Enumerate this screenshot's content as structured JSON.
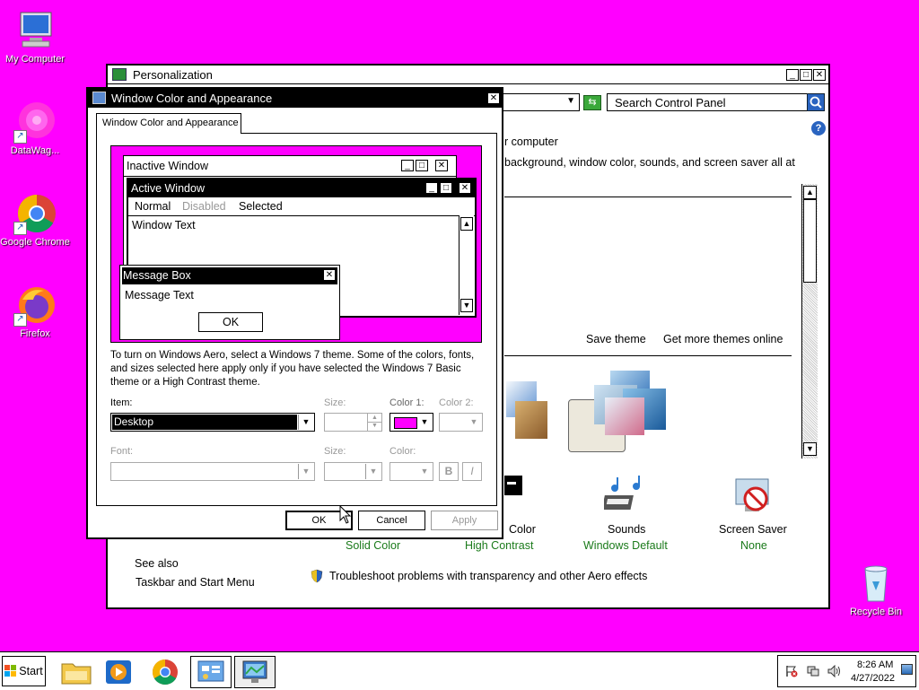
{
  "desktop": {
    "background": "#ff00ff",
    "icons": [
      {
        "label": "My Computer"
      },
      {
        "label": "DataWag..."
      },
      {
        "label": "Google Chrome"
      },
      {
        "label": "Firefox"
      },
      {
        "label": "Recycle Bin"
      }
    ]
  },
  "personalization": {
    "title": "Personalization",
    "search_placeholder": "Search Control Panel",
    "header_line1": "r computer",
    "header_line2": "background, window color, sounds, and screen saver all at",
    "save_theme": "Save theme",
    "get_more_themes": "Get more themes online",
    "bottom_items": [
      {
        "label": "Color",
        "value": "Solid Color"
      },
      {
        "label": "",
        "value": "High Contrast"
      },
      {
        "label": "Sounds",
        "value": "Windows Default"
      },
      {
        "label": "Screen Saver",
        "value": "None"
      }
    ],
    "see_also": "See also",
    "taskbar_link": "Taskbar and Start Menu",
    "troubleshoot": "Troubleshoot problems with transparency and other Aero effects"
  },
  "dialog": {
    "title": "Window Color and Appearance",
    "tab": "Window Color and Appearance",
    "preview": {
      "inactive_title": "Inactive Window",
      "active_title": "Active Window",
      "menu_normal": "Normal",
      "menu_disabled": "Disabled",
      "menu_selected": "Selected",
      "window_text": "Window Text",
      "msgbox_title": "Message Box",
      "msgbox_text": "Message Text",
      "msgbox_ok": "OK"
    },
    "info_text": "To turn on Windows Aero, select a Windows 7 theme.  Some of the colors, fonts, and sizes selected here apply only if you have selected the Windows 7 Basic theme or a High Contrast theme.",
    "item_label": "Item:",
    "item_value": "Desktop",
    "size_label": "Size:",
    "color1_label": "Color 1:",
    "color1_value": "#ff00ff",
    "color2_label": "Color 2:",
    "font_label": "Font:",
    "font_size_label": "Size:",
    "font_color_label": "Color:",
    "bold": "B",
    "italic": "I",
    "ok": "OK",
    "cancel": "Cancel",
    "apply": "Apply"
  },
  "taskbar": {
    "start": "Start",
    "time": "8:26 AM",
    "date": "4/27/2022"
  }
}
